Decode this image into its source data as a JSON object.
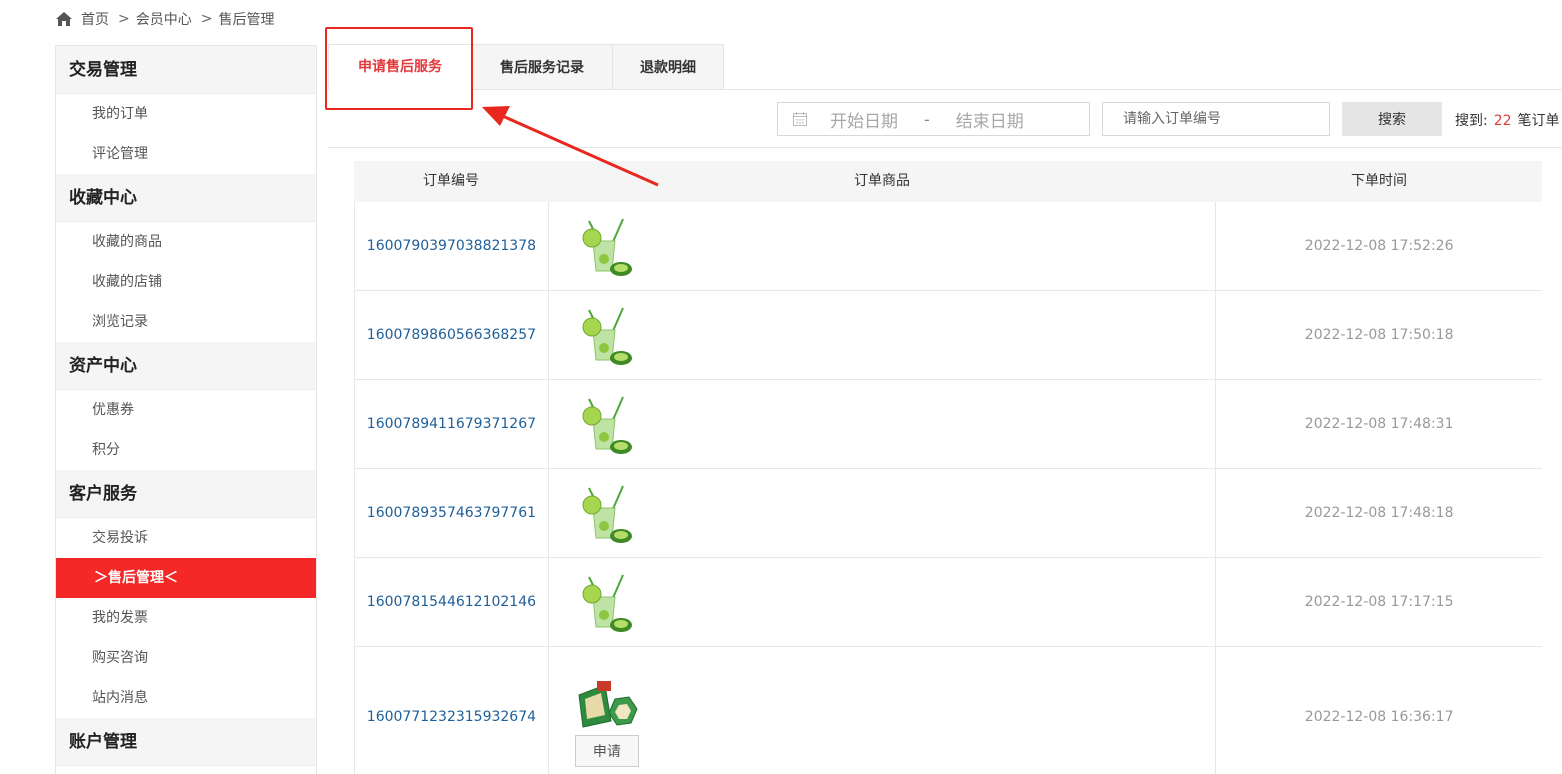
{
  "breadcrumb": {
    "home": "首页",
    "sep1": ">",
    "level2": "会员中心",
    "sep2": ">",
    "level3": "售后管理"
  },
  "sidebar": {
    "groups": [
      {
        "title": "交易管理",
        "items": [
          "我的订单",
          "评论管理"
        ]
      },
      {
        "title": "收藏中心",
        "items": [
          "收藏的商品",
          "收藏的店铺",
          "浏览记录"
        ]
      },
      {
        "title": "资产中心",
        "items": [
          "优惠券",
          "积分"
        ]
      },
      {
        "title": "客户服务",
        "items": [
          "交易投诉",
          "＞售后管理＜",
          "我的发票",
          "购买咨询",
          "站内消息"
        ]
      },
      {
        "title": "账户管理",
        "items": []
      }
    ]
  },
  "tabs": [
    "申请售后服务",
    "售后服务记录",
    "退款明细"
  ],
  "search": {
    "start_placeholder": "开始日期",
    "dash": "-",
    "end_placeholder": "结束日期",
    "order_placeholder": "请输入订单编号",
    "button": "搜索",
    "result_prefix": "搜到:",
    "result_count": "22",
    "result_suffix": "笔订单"
  },
  "table": {
    "headers": [
      "订单编号",
      "订单商品",
      "下单时间"
    ],
    "rows": [
      {
        "order_no": "1600790397038821378",
        "time": "2022-12-08 17:52:26"
      },
      {
        "order_no": "1600789860566368257",
        "time": "2022-12-08 17:50:18"
      },
      {
        "order_no": "1600789411679371267",
        "time": "2022-12-08 17:48:31"
      },
      {
        "order_no": "1600789357463797761",
        "time": "2022-12-08 17:48:18"
      },
      {
        "order_no": "1600781544612102146",
        "time": "2022-12-08 17:17:15"
      },
      {
        "order_no": "1600771232315932674",
        "time": "2022-12-08 16:36:17",
        "action": "申请"
      }
    ]
  },
  "colors": {
    "accent_red": "#f52828",
    "link_blue": "#1f5f9a",
    "annotation_red": "#e8281e"
  }
}
